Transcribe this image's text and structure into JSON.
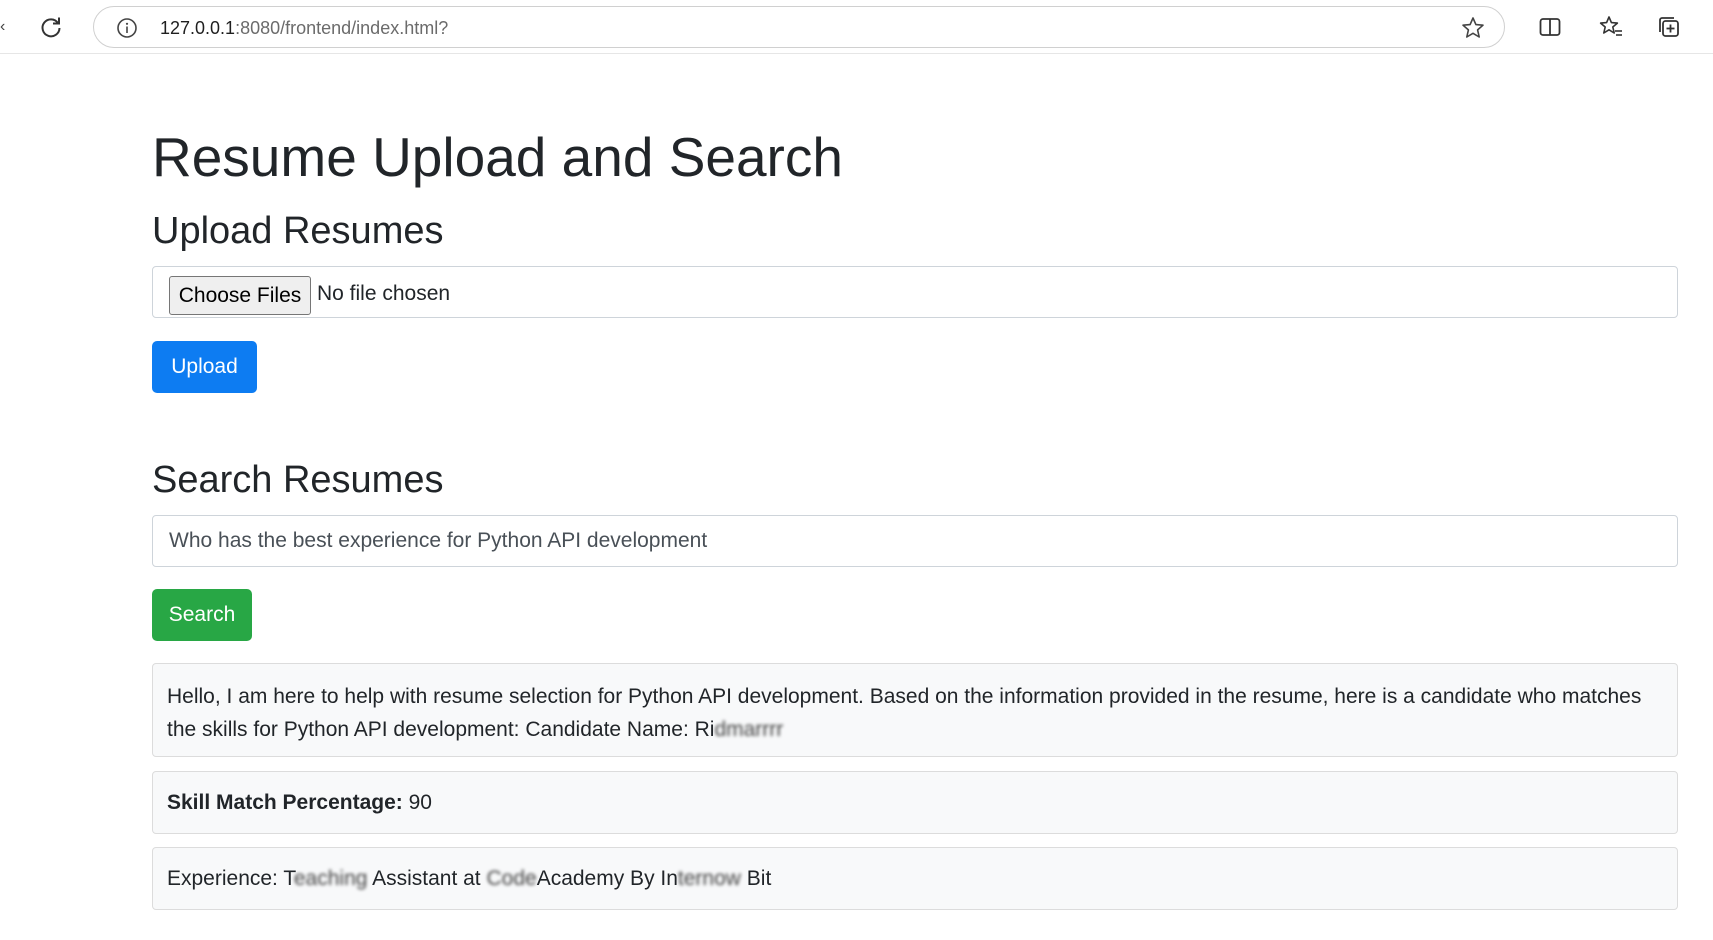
{
  "browser": {
    "url_host": "127.0.0.1",
    "url_rest": ":8080/frontend/index.html?",
    "icons": [
      "back-icon",
      "reload-icon",
      "info-icon",
      "star-icon",
      "split-view-icon",
      "favorites-icon",
      "collections-icon"
    ]
  },
  "page": {
    "title": "Resume Upload and Search",
    "upload": {
      "heading": "Upload Resumes",
      "choose_files_label": "Choose Files",
      "file_status": "No file chosen",
      "upload_button": "Upload"
    },
    "search": {
      "heading": "Search Resumes",
      "query_value": "Who has the best experience for Python API development",
      "search_button": "Search"
    },
    "results": {
      "summary": "Hello, I am here to help with resume selection for Python API development. Based on the information provided in the resume, here is a candidate who matches the skills for Python API development: Candidate Name: Ri",
      "summary_redacted": "dmarrrr",
      "skill_label": "Skill Match Percentage:",
      "skill_value": "90",
      "experience_prefix": "Experience: T",
      "experience_redacted_1": "eaching",
      "experience_mid": " Assistant at ",
      "experience_redacted_2": "Code",
      "experience_org": "Academy By In",
      "experience_redacted_3": "ternow",
      "experience_suffix": " Bit"
    }
  },
  "colors": {
    "primary": "#0d7cf2",
    "success": "#28a745",
    "text": "#212529",
    "border": "#ced4da",
    "result_bg": "#f8f9fa"
  }
}
